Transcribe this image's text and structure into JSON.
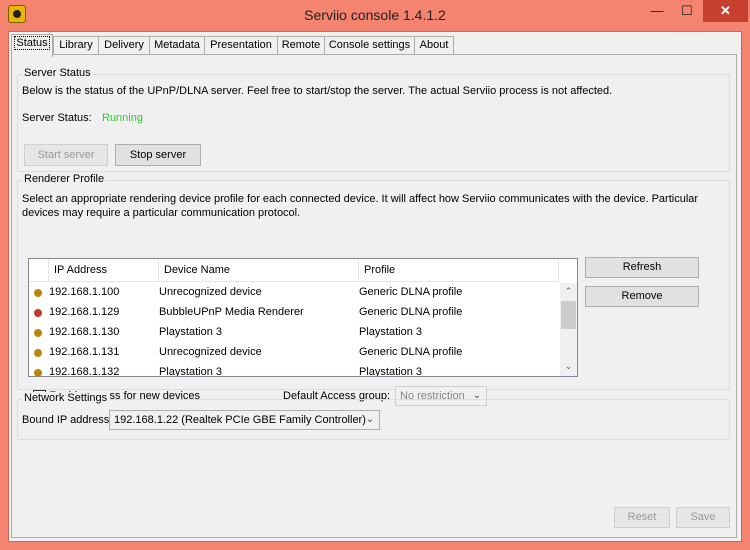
{
  "window": {
    "title": "Serviio console 1.4.1.2",
    "minimize_glyph": "—",
    "maximize_glyph": "☐",
    "close_glyph": "✕"
  },
  "tabs": [
    {
      "label": "Status",
      "active": true
    },
    {
      "label": "Library"
    },
    {
      "label": "Delivery"
    },
    {
      "label": "Metadata"
    },
    {
      "label": "Presentation"
    },
    {
      "label": "Remote"
    },
    {
      "label": "Console settings"
    },
    {
      "label": "About"
    }
  ],
  "server_status": {
    "group_title": "Server Status",
    "description": "Below is the status of the UPnP/DLNA server. Feel free to start/stop the server. The actual Serviio process is not affected.",
    "status_label": "Server Status:",
    "status_value": "Running",
    "status_color": "#33cc33",
    "start_label": "Start server",
    "stop_label": "Stop server"
  },
  "renderer_profile": {
    "group_title": "Renderer Profile",
    "description_line1": "Select an appropriate rendering device profile for each connected device. It will affect how Serviio communicates with the device. Particular",
    "description_line2": "devices may require a particular communication protocol.",
    "columns": [
      "IP Address",
      "Device Name",
      "Profile"
    ],
    "rows": [
      {
        "ip": "192.168.1.100",
        "device": "Unrecognized device",
        "profile": "Generic DLNA profile",
        "status_color": "#b8860b"
      },
      {
        "ip": "192.168.1.129",
        "device": "BubbleUPnP Media Renderer",
        "profile": "Generic DLNA profile",
        "status_color": "#c0392b"
      },
      {
        "ip": "192.168.1.130",
        "device": "Playstation 3",
        "profile": "Playstation 3",
        "status_color": "#b8860b"
      },
      {
        "ip": "192.168.1.131",
        "device": "Unrecognized device",
        "profile": "Generic DLNA profile",
        "status_color": "#b8860b"
      },
      {
        "ip": "192.168.1.132",
        "device": "Playstation 3",
        "profile": "Playstation 3",
        "status_color": "#b8860b"
      }
    ],
    "refresh_label": "Refresh",
    "remove_label": "Remove",
    "enable_access_label": "Enable access for new devices",
    "enable_access_checked": "✔",
    "default_access_label": "Default Access group:",
    "default_access_value": "No restriction"
  },
  "network_settings": {
    "group_title": "Network Settings",
    "bound_ip_label": "Bound IP address:",
    "bound_ip_value": "192.168.1.22 (Realtek PCIe GBE Family Controller)"
  },
  "footer": {
    "reset_label": "Reset",
    "save_label": "Save"
  },
  "icons": {
    "app": "serviio-app-icon",
    "combo_arrow": "⌄",
    "scroll_up": "⌃",
    "scroll_down": "⌄"
  }
}
